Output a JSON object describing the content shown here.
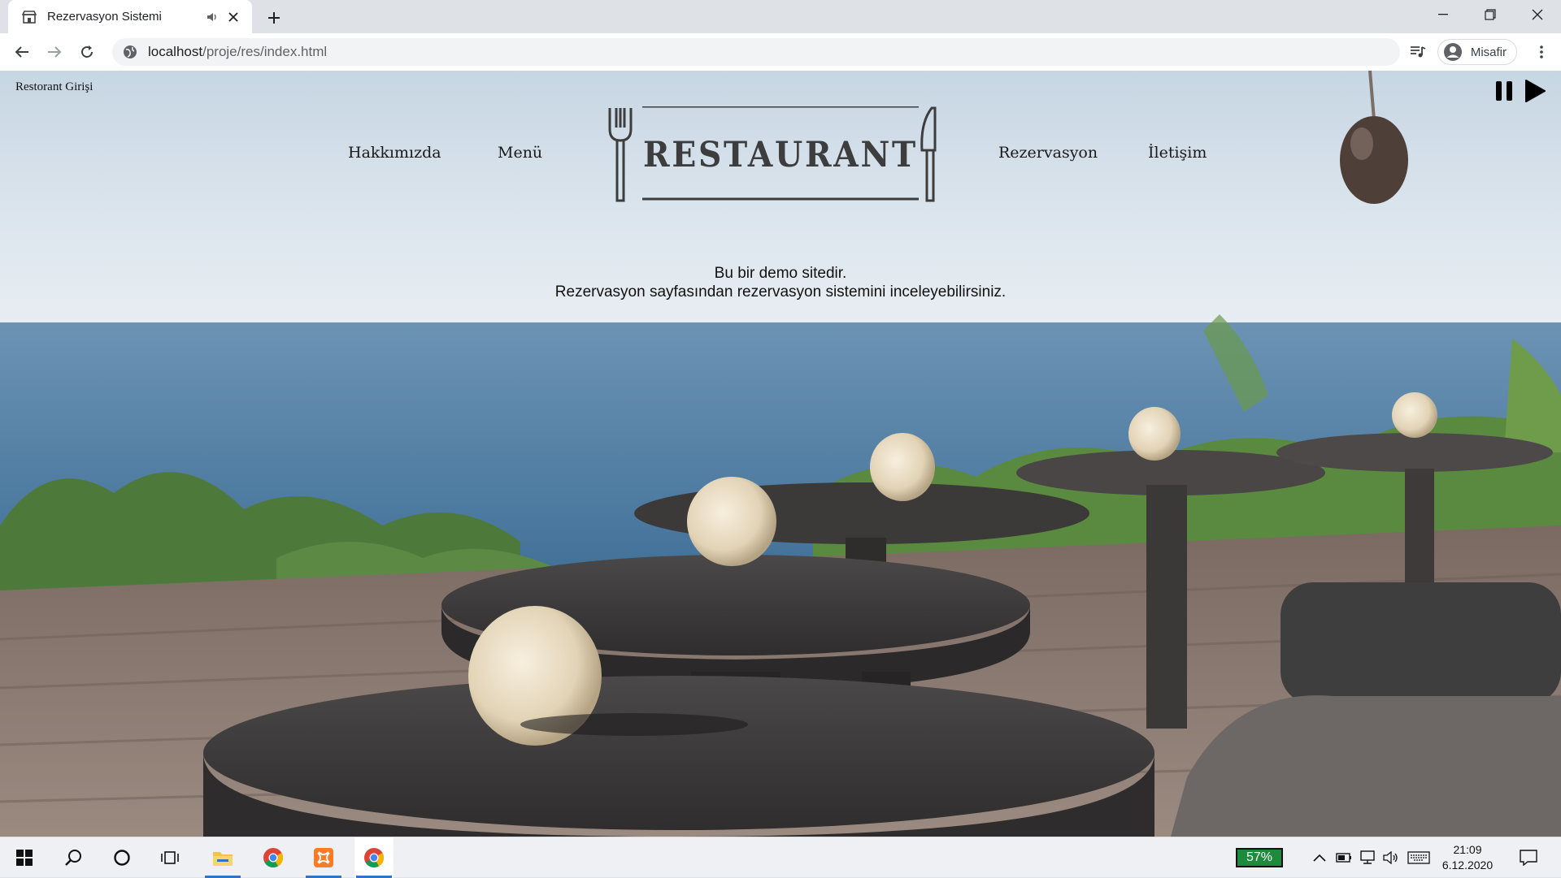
{
  "browser": {
    "tab_title": "Rezervasyon Sistemi",
    "url_host": "localhost",
    "url_path": "/proje/res/index.html",
    "profile_name": "Misafir",
    "icons": [
      "restaurant-favicon-icon",
      "speaker-icon",
      "close-icon",
      "plus-icon",
      "minimize-icon",
      "maximize-icon",
      "window-close-icon",
      "back-icon",
      "forward-icon",
      "reload-icon",
      "globe-icon",
      "media-control-icon",
      "avatar-icon",
      "kebab-menu-icon"
    ]
  },
  "page": {
    "login_link": "Restorant Girişi",
    "nav": {
      "about": "Hakkımızda",
      "menu": "Menü",
      "reservation": "Rezervasyon",
      "contact": "İletişim"
    },
    "logo_text": "RESTAURANT",
    "intro_line1": "Bu bir demo sitedir.",
    "intro_line2": "Rezervasyon sayfasından rezervasyon sistemini inceleyebilirsiniz.",
    "music_controls": [
      "pause-icon",
      "play-icon"
    ]
  },
  "taskbar": {
    "battery_text": "57%",
    "time": "21:09",
    "date": "6.12.2020",
    "icons": [
      "windows-start-icon",
      "search-icon",
      "cortana-icon",
      "task-view-icon",
      "file-explorer-icon",
      "chrome-icon",
      "xampp-icon",
      "chrome-icon",
      "chevron-up-icon",
      "battery-icon",
      "network-icon",
      "volume-icon",
      "keyboard-icon",
      "notifications-icon"
    ]
  },
  "colors": {
    "accent": "#2f74c8",
    "logo": "#3d3d3d",
    "battery_bg": "#1e8b3c"
  }
}
